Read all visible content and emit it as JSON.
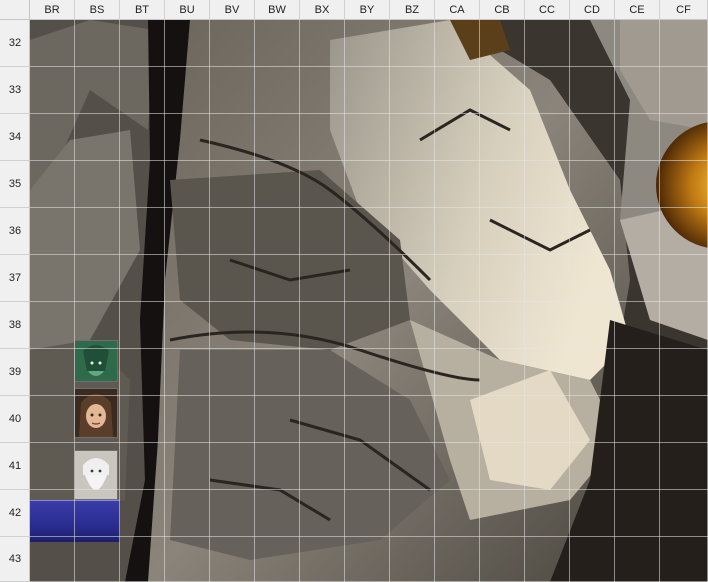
{
  "columns": [
    "BR",
    "BS",
    "BT",
    "BU",
    "BV",
    "BW",
    "BX",
    "BY",
    "BZ",
    "CA",
    "CB",
    "CC",
    "CD",
    "CE",
    "CF"
  ],
  "rows": [
    "32",
    "33",
    "34",
    "35",
    "36",
    "37",
    "38",
    "39",
    "40",
    "41",
    "42",
    "43"
  ],
  "images": {
    "background": "rock-cliff-texture",
    "portraits": [
      "green-elf-portrait",
      "hooded-ranger-portrait",
      "white-bearded-wizard-portrait"
    ],
    "orb": "golden-orb-icon",
    "bar": "blue-selection-bar"
  },
  "colors": {
    "header_bg": "#f0f0f0",
    "grid": "#d0d0d0",
    "rock_dark": "#2f2a25",
    "rock_light": "#c9c2b3",
    "bar": "#2a2d90"
  }
}
